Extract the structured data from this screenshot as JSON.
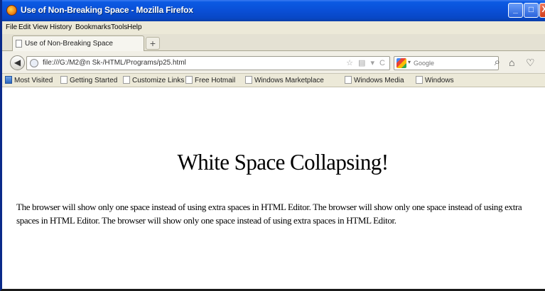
{
  "window": {
    "title": "Use of Non-Breaking Space - Mozilla Firefox",
    "minimize": "_",
    "maximize": "□",
    "close": "X"
  },
  "menu": [
    "File",
    "Edit",
    "View",
    "History",
    "Bookmarks",
    "Tools",
    "Help"
  ],
  "tab": {
    "label": "Use of Non-Breaking Space",
    "new_tab": "+"
  },
  "nav": {
    "back": "◀",
    "url": "file:///G:/M2@n Sk-/HTML/Programs/p25.html",
    "url_icons": "☆ ▤ ▾ C",
    "search_placeholder": "Google",
    "search_dropdown": "▾",
    "search_button": "⌕",
    "home": "⌂",
    "shield": "♡"
  },
  "bookmarks": [
    "Most Visited",
    "Getting Started",
    "Customize Links",
    "Free Hotmail",
    "Windows Marketplace",
    "Windows Media",
    "Windows"
  ],
  "page": {
    "heading": "White Space Collapsing!",
    "paragraph": "The browser will show only one space instead of using extra spaces in HTML Editor. The browser will show only one space instead of using extra spaces in HTML Editor. The browser will show only one space instead of using extra spaces in HTML Editor."
  },
  "colors": {
    "titlebar": "#0a4fd6",
    "chrome": "#ece9d8",
    "close_button": "#cf3b1a"
  }
}
